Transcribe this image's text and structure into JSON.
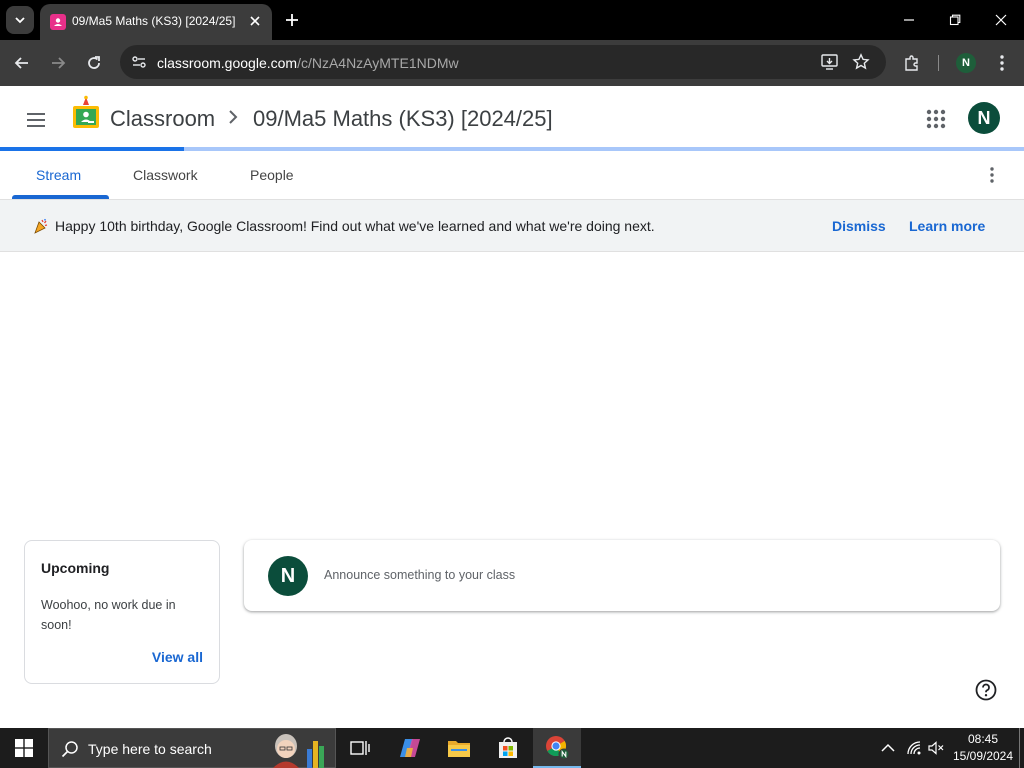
{
  "browser": {
    "tab_title": "09/Ma5 Maths (KS3) [2024/25]",
    "url_host": "classroom.google.com",
    "url_path": "/c/NzA4NzAyMTE1NDMw",
    "profile_initial": "N"
  },
  "header": {
    "app_name": "Classroom",
    "class_name": "09/Ma5 Maths (KS3) [2024/25]",
    "avatar_initial": "N"
  },
  "progress": {
    "value_percent": 18
  },
  "tabs": [
    {
      "label": "Stream",
      "active": true
    },
    {
      "label": "Classwork",
      "active": false
    },
    {
      "label": "People",
      "active": false
    }
  ],
  "banner": {
    "text": "Happy 10th birthday, Google Classroom! Find out what we've learned and what we're doing next.",
    "dismiss_label": "Dismiss",
    "learn_more_label": "Learn more"
  },
  "upcoming": {
    "title": "Upcoming",
    "body": "Woohoo, no work due in soon!",
    "link_label": "View all"
  },
  "announce": {
    "avatar_initial": "N",
    "placeholder": "Announce something to your class"
  },
  "taskbar": {
    "search_placeholder": "Type here to search",
    "time": "08:45",
    "date": "15/09/2024"
  },
  "colors": {
    "accent": "#1967d2",
    "avatar": "#0b4d3b",
    "progress_track": "#a8c7fa",
    "progress_fill": "#1a73e8"
  }
}
